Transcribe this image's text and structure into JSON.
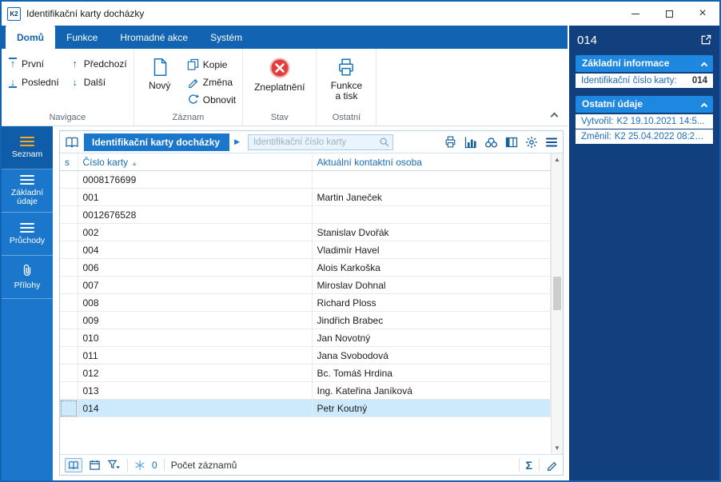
{
  "window": {
    "title": "Identifikační karty docházky",
    "app_icon": "K2"
  },
  "icons": {
    "minimize": "",
    "close": "×",
    "play": "▶",
    "sort_asc": "▲",
    "sigma": "Σ",
    "scroll_up": "▲",
    "scroll_down": "▼"
  },
  "ribbon": {
    "tabs": [
      {
        "label": "Domů"
      },
      {
        "label": "Funkce"
      },
      {
        "label": "Hromadné akce"
      },
      {
        "label": "Systém"
      }
    ],
    "groups": [
      {
        "label": "Navigace",
        "buttons": [
          {
            "label": "První"
          },
          {
            "label": "Poslední"
          },
          {
            "label": "Předchozí"
          },
          {
            "label": "Další"
          }
        ]
      },
      {
        "label": "Záznam",
        "buttons": [
          {
            "label": "Nový"
          },
          {
            "label": "Kopie"
          },
          {
            "label": "Změna"
          },
          {
            "label": "Obnovit"
          }
        ]
      },
      {
        "label": "Stav",
        "buttons": [
          {
            "label": "Zneplatnění"
          }
        ]
      },
      {
        "label": "Ostatní",
        "buttons": [
          {
            "label": "Funkce a tisk"
          }
        ]
      }
    ]
  },
  "sidebar": {
    "items": [
      {
        "label": "Seznam"
      },
      {
        "label": "Základní údaje"
      },
      {
        "label": "Průchody"
      },
      {
        "label": "Přílohy"
      }
    ]
  },
  "content": {
    "header": {
      "title": "Identifikační karty docházky",
      "search_placeholder": "Identifikační číslo karty"
    },
    "table": {
      "columns": [
        "s",
        "Číslo karty",
        "Aktuální kontaktní osoba"
      ],
      "rows": [
        {
          "card": "0008176699",
          "person": ""
        },
        {
          "card": "001",
          "person": "Martin Janeček"
        },
        {
          "card": "0012676528",
          "person": ""
        },
        {
          "card": "002",
          "person": "Stanislav Dvořák"
        },
        {
          "card": "004",
          "person": "Vladimír Havel"
        },
        {
          "card": "006",
          "person": "Alois Karkoška"
        },
        {
          "card": "007",
          "person": "Miroslav Dohnal"
        },
        {
          "card": "008",
          "person": "Richard Ploss"
        },
        {
          "card": "009",
          "person": "Jindřich Brabec"
        },
        {
          "card": "010",
          "person": "Jan Novotný"
        },
        {
          "card": "011",
          "person": "Jana Svobodová"
        },
        {
          "card": "012",
          "person": "Bc. Tomáš Hrdina"
        },
        {
          "card": "013",
          "person": "Ing. Kateřina Janíková"
        },
        {
          "card": "014",
          "person": "Petr Koutný",
          "selected": true
        }
      ]
    },
    "statusbar": {
      "filter_count": "0",
      "records_label": "Počet záznamů"
    }
  },
  "detail_panel": {
    "title": "014",
    "sections": [
      {
        "label": "Základní informace",
        "fields": [
          {
            "label": "Identifikační číslo karty:",
            "value": "014"
          }
        ]
      },
      {
        "label": "Ostatní údaje",
        "fields": [
          {
            "label": "Vytvořil:",
            "value": "K2 19.10.2021 14:5..."
          },
          {
            "label": "Změnil:",
            "value": "K2 25.04.2022 08:25..."
          }
        ]
      }
    ]
  }
}
